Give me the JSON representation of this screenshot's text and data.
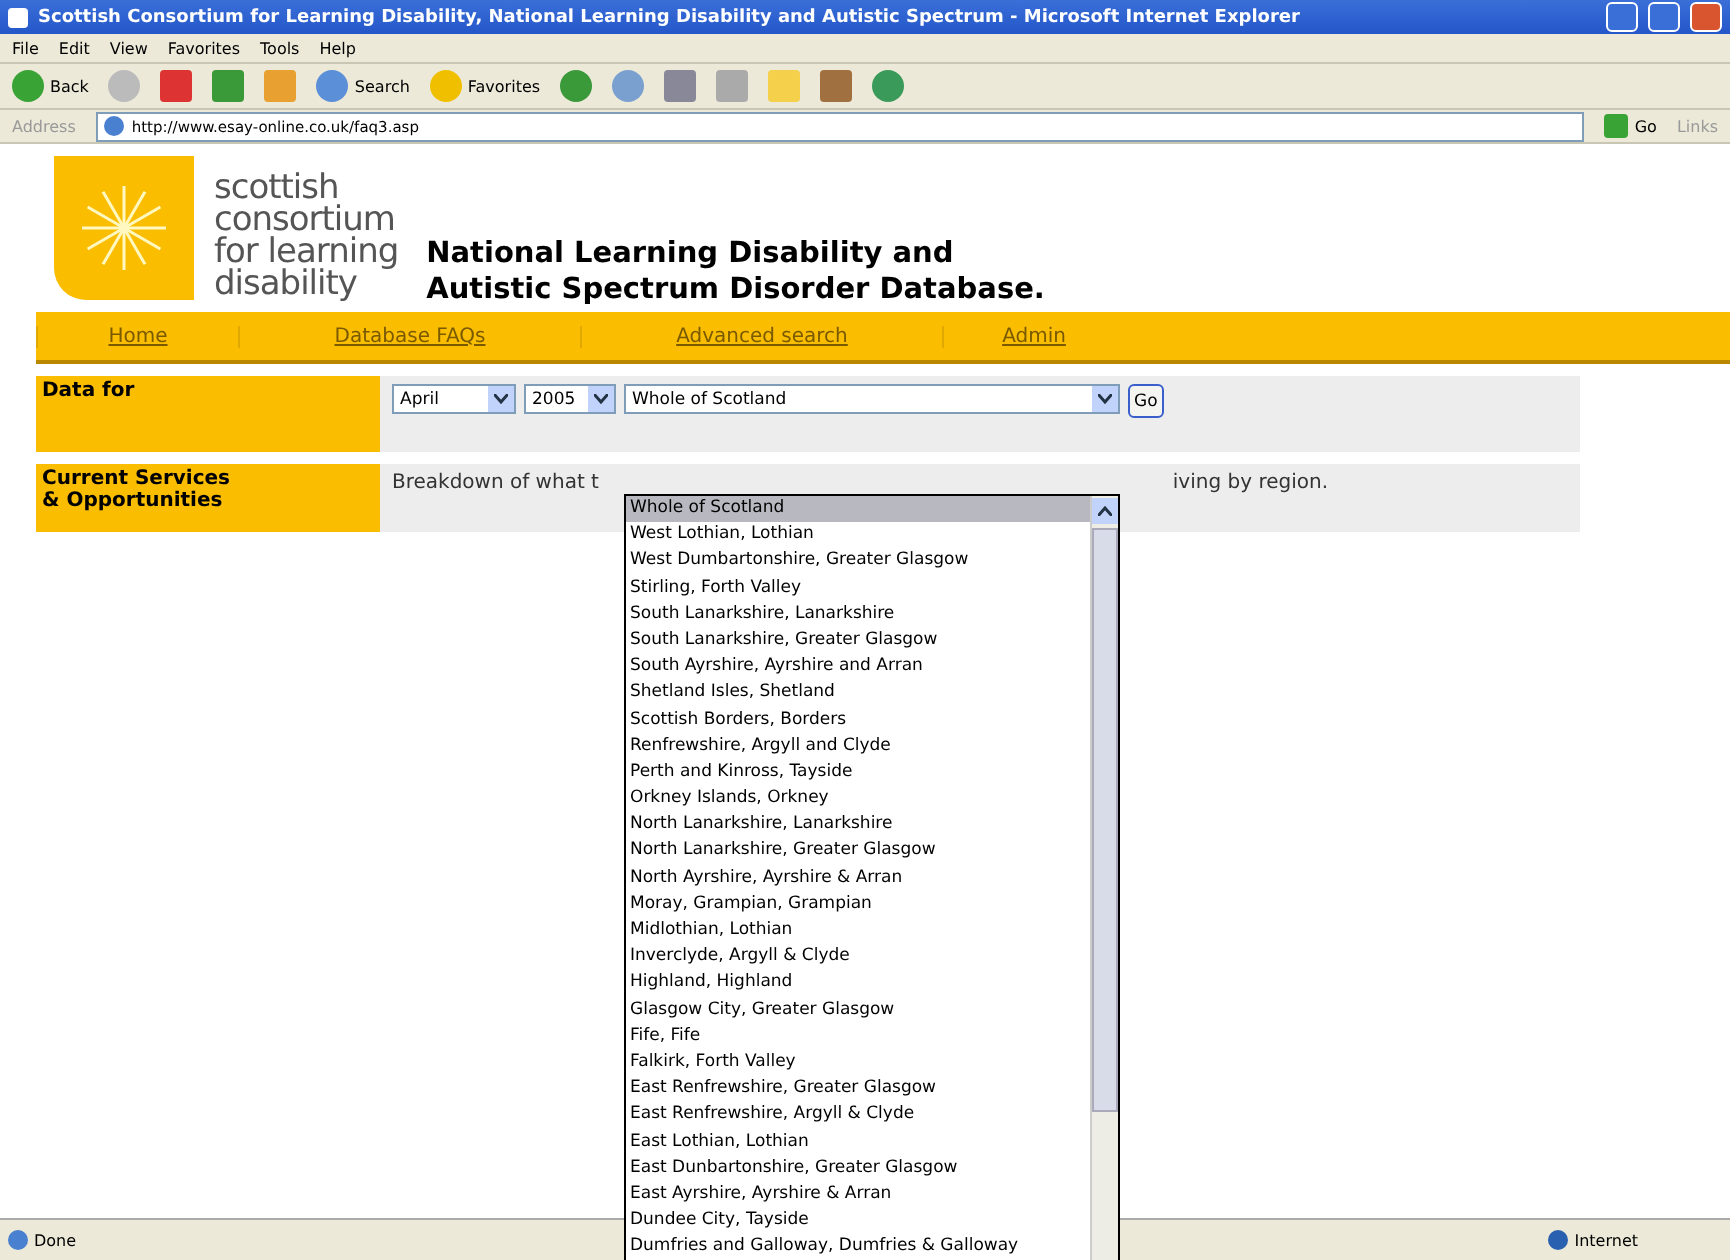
{
  "window": {
    "title": "Scottish Consortium for Learning Disability, National Learning Disability and Autistic Spectrum - Microsoft Internet Explorer"
  },
  "menu": [
    "File",
    "Edit",
    "View",
    "Favorites",
    "Tools",
    "Help"
  ],
  "toolbar": {
    "back": "Back",
    "search": "Search",
    "favorites": "Favorites"
  },
  "address": {
    "label": "Address",
    "url": "http://www.esay-online.co.uk/faq3.asp",
    "go": "Go",
    "links": "Links"
  },
  "logo": {
    "lines": [
      "scottish",
      "consortium",
      "for learning",
      "disability"
    ]
  },
  "heading": [
    "National Learning Disability and",
    "Autistic Spectrum Disorder Database."
  ],
  "nav": [
    "Home",
    "Database FAQs",
    "Advanced search",
    "Admin"
  ],
  "rows": [
    {
      "label": "Data for",
      "kind": "controls"
    },
    {
      "label": "Current Services\n& Opportunities",
      "kind": "text",
      "text_before": "Breakdown of what t",
      "text_after": "iving by region."
    }
  ],
  "controls": {
    "month": "April",
    "year": "2005",
    "region": "Whole of Scotland",
    "go": "Go"
  },
  "dropdown": [
    {
      "label": "Whole of Scotland",
      "selected": true
    },
    {
      "label": "West Lothian, Lothian",
      "selected": false
    },
    {
      "label": "West Dumbartonshire, Greater Glasgow",
      "selected": false
    },
    {
      "label": "Stirling, Forth Valley",
      "selected": false
    },
    {
      "label": "South Lanarkshire, Lanarkshire",
      "selected": false
    },
    {
      "label": "South Lanarkshire, Greater Glasgow",
      "selected": false
    },
    {
      "label": "South Ayrshire, Ayrshire and Arran",
      "selected": false
    },
    {
      "label": "Shetland Isles, Shetland",
      "selected": false
    },
    {
      "label": "Scottish Borders, Borders",
      "selected": false
    },
    {
      "label": "Renfrewshire, Argyll and Clyde",
      "selected": false
    },
    {
      "label": "Perth and Kinross, Tayside",
      "selected": false
    },
    {
      "label": "Orkney Islands, Orkney",
      "selected": false
    },
    {
      "label": "North Lanarkshire, Lanarkshire",
      "selected": false
    },
    {
      "label": "North Lanarkshire, Greater Glasgow",
      "selected": false
    },
    {
      "label": "North Ayrshire, Ayrshire & Arran",
      "selected": false
    },
    {
      "label": "Moray, Grampian, Grampian",
      "selected": false
    },
    {
      "label": "Midlothian, Lothian",
      "selected": false
    },
    {
      "label": "Inverclyde, Argyll & Clyde",
      "selected": false
    },
    {
      "label": "Highland, Highland",
      "selected": false
    },
    {
      "label": "Glasgow City, Greater Glasgow",
      "selected": false
    },
    {
      "label": "Fife, Fife",
      "selected": false
    },
    {
      "label": "Falkirk, Forth Valley",
      "selected": false
    },
    {
      "label": "East Renfrewshire, Greater Glasgow",
      "selected": false
    },
    {
      "label": "East Renfrewshire, Argyll & Clyde",
      "selected": false
    },
    {
      "label": "East Lothian, Lothian",
      "selected": false
    },
    {
      "label": "East Dunbartonshire, Greater Glasgow",
      "selected": false
    },
    {
      "label": "East Ayrshire, Ayrshire & Arran",
      "selected": false
    },
    {
      "label": "Dundee City, Tayside",
      "selected": false
    },
    {
      "label": "Dumfries and Galloway, Dumfries & Galloway",
      "selected": false
    }
  ],
  "status_bar": {
    "left": "Done",
    "right": "Internet"
  }
}
